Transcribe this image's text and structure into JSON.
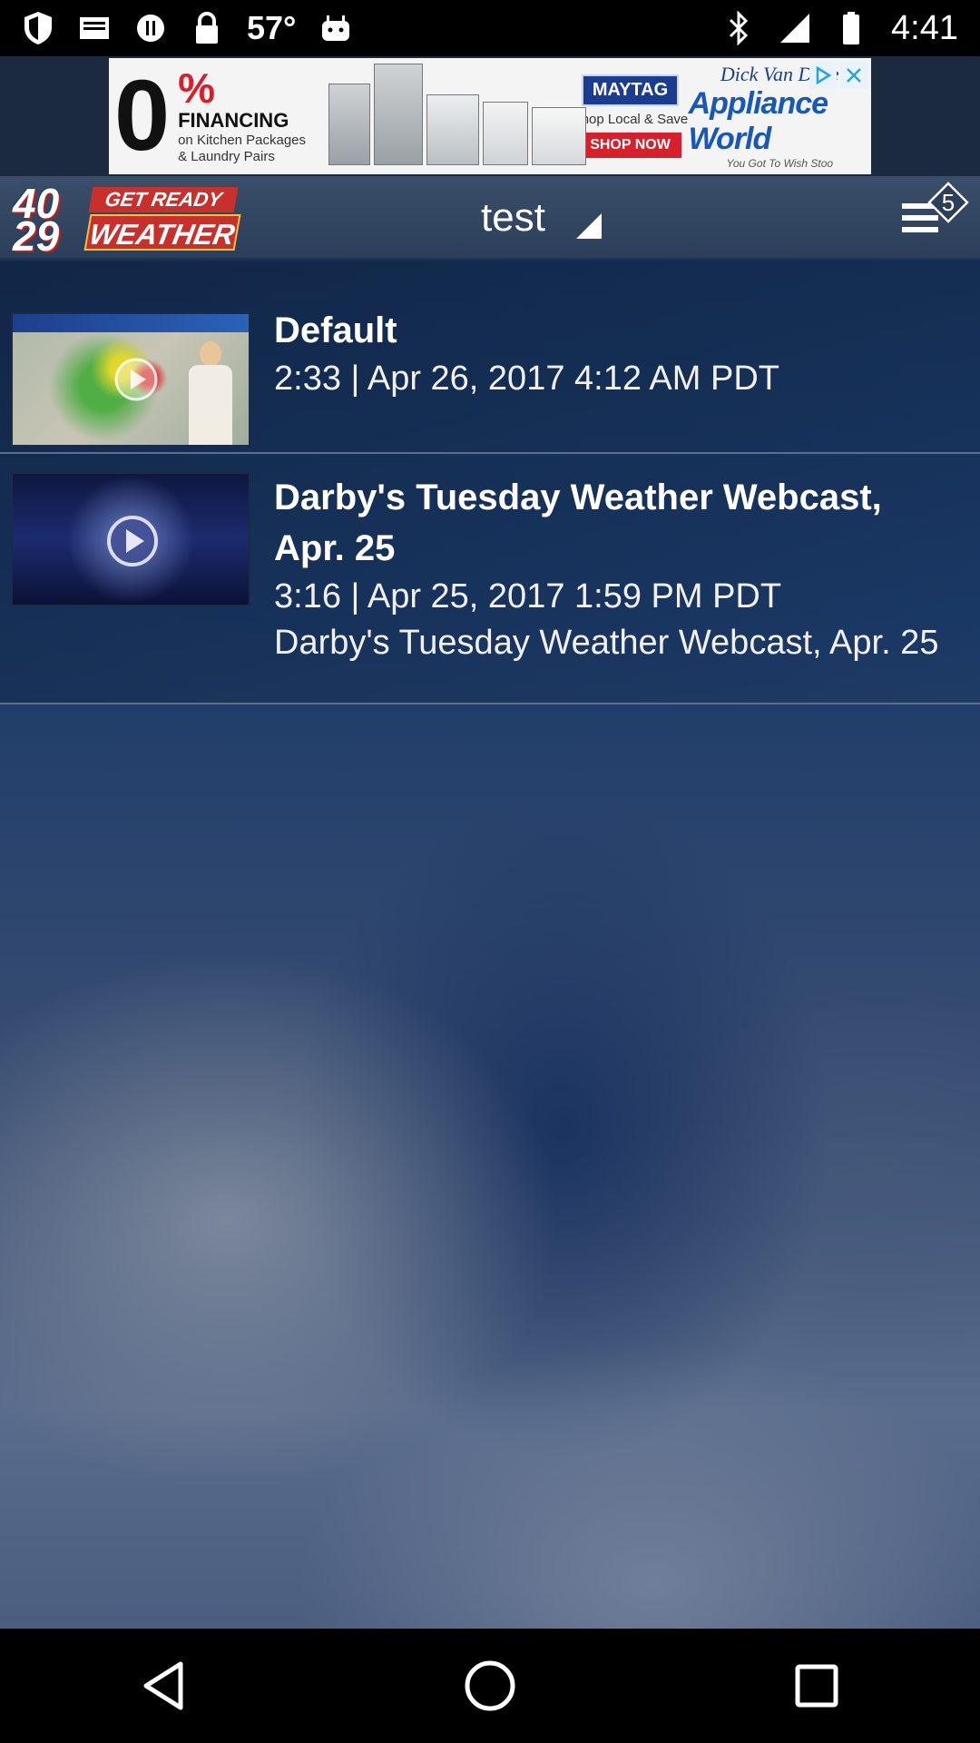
{
  "status_bar": {
    "temperature": "57°",
    "time": "4:41",
    "icons": [
      "shield-icon",
      "mail-icon",
      "info-icon",
      "lock-icon",
      "android-icon",
      "bluetooth-icon",
      "signal-icon",
      "battery-icon"
    ]
  },
  "ad": {
    "zero": "0",
    "percent": "%",
    "financing": "FINANCING",
    "on_kitchen": "on Kitchen Packages",
    "laundry": "& Laundry Pairs",
    "maytag": "MAYTAG",
    "shop_local": "Shop Local & Save",
    "shop_now": "SHOP NOW",
    "dick_van_dyke": "Dick Van Dyke",
    "appliance_world": "Appliance World",
    "tagline": "You Got To Wish Stoo"
  },
  "header": {
    "logo_number": "40 29",
    "logo_top": "GET READY",
    "logo_bottom": "WEATHER",
    "location": "test",
    "badge_count": "5"
  },
  "videos": [
    {
      "title": "Default",
      "meta": "2:33 | Apr 26, 2017 4:12 AM PDT",
      "description": ""
    },
    {
      "title": "Darby's Tuesday Weather Webcast, Apr. 25",
      "meta": "3:16 | Apr 25, 2017 1:59 PM PDT",
      "description": "Darby's Tuesday Weather Webcast, Apr. 25"
    }
  ],
  "colors": {
    "header_bg": "#3b4e69",
    "logo_red": "#c9302c",
    "divider": "#5c6f8e"
  }
}
